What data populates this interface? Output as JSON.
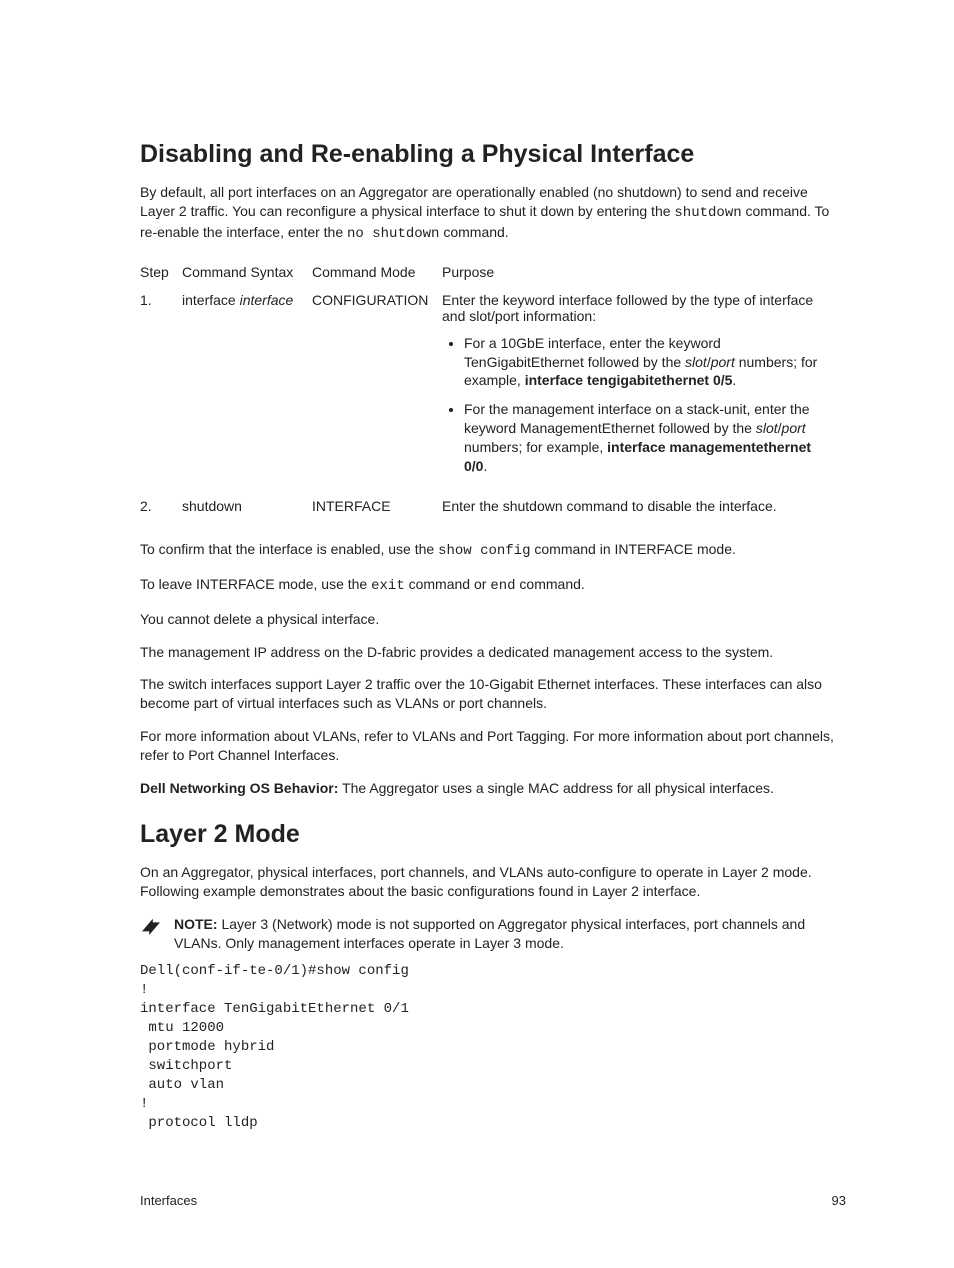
{
  "section1": {
    "heading": "Disabling and Re-enabling a Physical Interface",
    "intro_pre": "By default, all port interfaces on an Aggregator are operationally enabled (no shutdown) to send and receive Layer 2 traffic. You can reconfigure a physical interface to shut it down by entering the ",
    "intro_code1": "shutdown",
    "intro_mid": " command. To re-enable the interface, enter the ",
    "intro_code2": "no shutdown",
    "intro_post": " command.",
    "table": {
      "head_step": "Step",
      "head_syntax": "Command Syntax",
      "head_mode": "Command Mode",
      "head_purpose": "Purpose",
      "row1": {
        "step": "1.",
        "syntax_pre": "interface ",
        "syntax_italic": "interface",
        "mode": "CONFIGURATION",
        "purpose_intro": "Enter the keyword interface followed by the type of interface and slot/port information:",
        "b1_pre": "For a 10GbE interface, enter the keyword TenGigabitEthernet followed by the ",
        "b1_slot": "slot",
        "b1_slash": "/",
        "b1_port": "port",
        "b1_mid": " numbers; for example, ",
        "b1_bold": "interface tengigabitethernet 0/5",
        "b1_end": ".",
        "b2_pre": "For the management interface on a stack-unit, enter the keyword ManagementEthernet followed by the ",
        "b2_slot": "slot",
        "b2_slash": "/",
        "b2_port": "port",
        "b2_mid": " numbers; for example, ",
        "b2_bold": "interface managementethernet 0/0",
        "b2_end": "."
      },
      "row2": {
        "step": "2.",
        "syntax": "shutdown",
        "mode": "INTERFACE",
        "purpose": "Enter the shutdown command to disable the interface."
      }
    },
    "p_confirm_pre": "To confirm that the interface is enabled, use the ",
    "p_confirm_code": "show config",
    "p_confirm_post": " command in INTERFACE mode.",
    "p_leave_pre": "To leave INTERFACE mode, use the ",
    "p_leave_code1": "exit",
    "p_leave_mid": " command or ",
    "p_leave_code2": "end",
    "p_leave_post": " command.",
    "p_nodelete": "You cannot delete a physical interface.",
    "p_mgmt": "The management IP address on the D-fabric provides a dedicated management access to the system.",
    "p_switch": "The switch interfaces support Layer 2 traffic over the 10-Gigabit Ethernet interfaces. These interfaces can also become part of virtual interfaces such as VLANs or port channels.",
    "p_moreinfo": "For more information about VLANs, refer to VLANs and Port Tagging. For more information about port channels, refer to Port Channel Interfaces.",
    "p_behavior_bold": "Dell Networking OS Behavior:",
    "p_behavior_text": " The Aggregator uses a single MAC address for all physical interfaces."
  },
  "section2": {
    "heading": "Layer 2 Mode",
    "intro": "On an Aggregator, physical interfaces, port channels, and VLANs auto-configure to operate in Layer 2 mode. Following example demonstrates about the basic configurations found in Layer 2 interface.",
    "note_label": "NOTE:",
    "note_text": " Layer 3 (Network) mode is not supported on Aggregator physical interfaces, port channels and VLANs. Only management interfaces operate in Layer 3 mode.",
    "code": "Dell(conf-if-te-0/1)#show config\n!\ninterface TenGigabitEthernet 0/1\n mtu 12000\n portmode hybrid\n switchport\n auto vlan\n!\n protocol lldp"
  },
  "footer": {
    "left": "Interfaces",
    "right": "93"
  }
}
